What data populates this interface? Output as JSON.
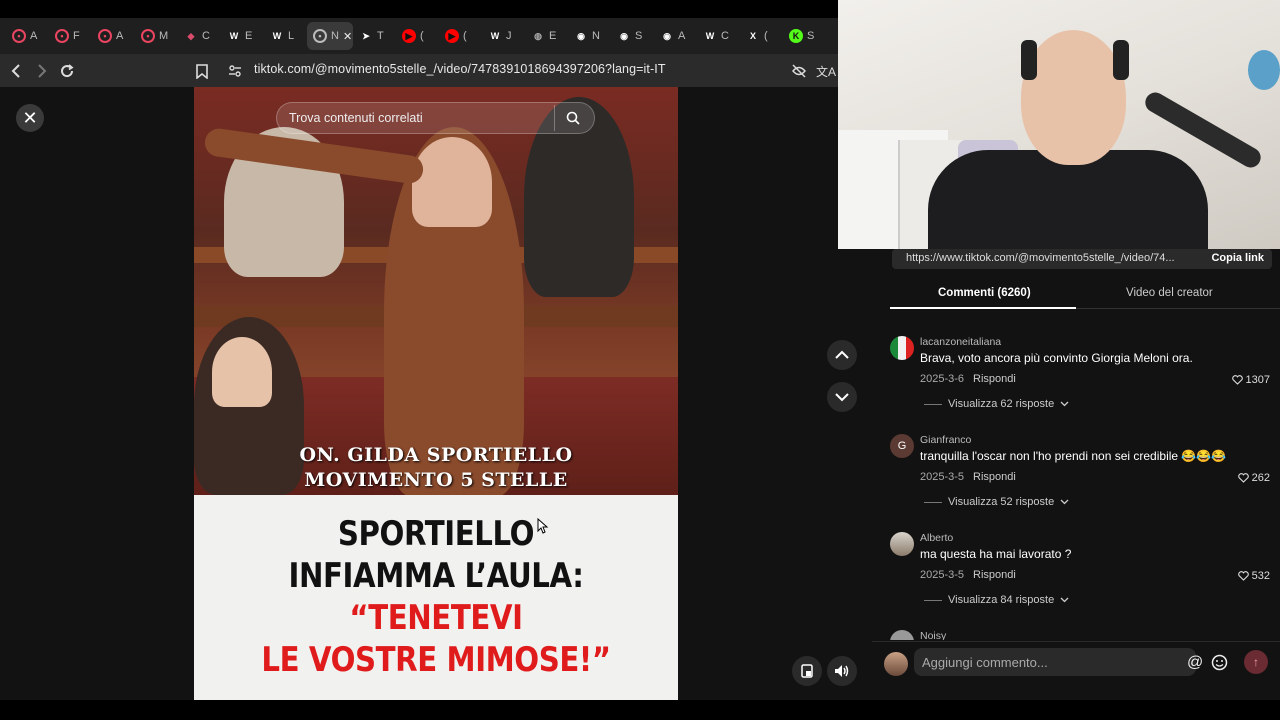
{
  "browser": {
    "tabs": [
      {
        "label": "A",
        "icon": "tiktok-icon",
        "color": "#e94560"
      },
      {
        "label": "F",
        "icon": "tiktok-icon",
        "color": "#e94560"
      },
      {
        "label": "A",
        "icon": "tiktok-icon",
        "color": "#e94560"
      },
      {
        "label": "M",
        "icon": "tiktok-icon",
        "color": "#e94560"
      },
      {
        "label": "C",
        "icon": "pocket-icon",
        "color": "#d94b6a"
      },
      {
        "label": "E",
        "icon": "wordpress-icon",
        "color": "#ffffff"
      },
      {
        "label": "L",
        "icon": "wordpress-icon",
        "color": "#ffffff"
      },
      {
        "label": "N",
        "icon": "tiktok-icon",
        "color": "#bbbbbb",
        "active": true
      },
      {
        "label": "T",
        "icon": "play-icon",
        "color": "#ffffff"
      },
      {
        "label": "(",
        "icon": "youtube-icon",
        "color": "#ff0000"
      },
      {
        "label": "(",
        "icon": "youtube-icon",
        "color": "#ff0000"
      },
      {
        "label": "J",
        "icon": "wikipedia-icon",
        "color": "#ffffff"
      },
      {
        "label": "E",
        "icon": "globe-icon",
        "color": "#aaaaaa"
      },
      {
        "label": "N",
        "icon": "openai-icon",
        "color": "#ffffff"
      },
      {
        "label": "S",
        "icon": "openai-icon",
        "color": "#ffffff"
      },
      {
        "label": "A",
        "icon": "openai-icon",
        "color": "#ffffff"
      },
      {
        "label": "C",
        "icon": "wikipedia-icon",
        "color": "#ffffff"
      },
      {
        "label": "(",
        "icon": "x-icon",
        "color": "#ffffff"
      },
      {
        "label": "S",
        "icon": "kick-icon",
        "color": "#53fc18"
      }
    ],
    "url": "tiktok.com/@movimento5stelle_/video/7478391018694397206?lang=it-IT"
  },
  "video": {
    "search_placeholder": "Trova contenuti correlati",
    "caption_line1": "On. Gilda Sportiello",
    "caption_line2": "Movimento 5 Stelle",
    "headline_line1": "SPORTIELLO",
    "headline_line2": "INFIAMMA L’AULA:",
    "headline_line3": "“TENETEVI",
    "headline_line4": "LE VOSTRE MIMOSE!”",
    "headline_accent": "#e01b1b"
  },
  "panel": {
    "share_url": "https://www.tiktok.com/@movimento5stelle_/video/74...",
    "copy_link": "Copia link",
    "tab_comments": "Commenti (6260)",
    "tab_creator": "Video del creator",
    "comments": [
      {
        "user": "lacanzoneitaliana",
        "text": "Brava, voto ancora più convinto Giorgia Meloni ora.",
        "date": "2025-3-6",
        "reply": "Rispondi",
        "likes": "1307",
        "thread": "Visualizza 62 risposte"
      },
      {
        "user": "Gianfranco",
        "text": "tranquilla l'oscar non l'ho prendi non sei credibile 😂😂😂",
        "date": "2025-3-5",
        "reply": "Rispondi",
        "likes": "262",
        "thread": "Visualizza 52 risposte",
        "initial": "G"
      },
      {
        "user": "Alberto",
        "text": "ma questa ha mai lavorato ?",
        "date": "2025-3-5",
        "reply": "Rispondi",
        "likes": "532",
        "thread": "Visualizza 84 risposte"
      },
      {
        "user": "Noisy"
      }
    ],
    "composer_placeholder": "Aggiungi commento..."
  }
}
